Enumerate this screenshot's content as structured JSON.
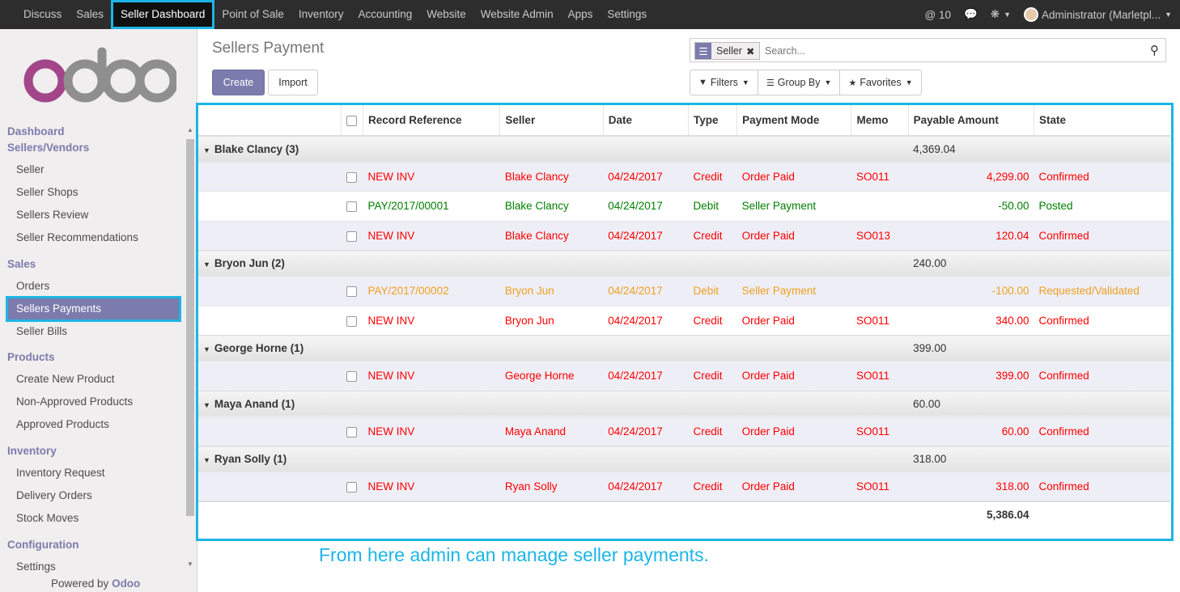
{
  "topbar": {
    "menu": [
      "Discuss",
      "Sales",
      "Seller Dashboard",
      "Point of Sale",
      "Inventory",
      "Accounting",
      "Website",
      "Website Admin",
      "Apps",
      "Settings"
    ],
    "active": "Seller Dashboard",
    "notifications": "@ 10",
    "user": "Administrator (Marletpl..."
  },
  "sidebar": {
    "logo_text": "odoo",
    "sections": [
      {
        "head": "Dashboard"
      },
      {
        "head": "Sellers/Vendors",
        "items": [
          "Seller",
          "Seller Shops",
          "Sellers Review",
          "Seller Recommendations"
        ]
      },
      {
        "head": "Sales",
        "items": [
          "Orders",
          "Sellers Payments",
          "Seller Bills"
        ]
      },
      {
        "head": "Products",
        "items": [
          "Create New Product",
          "Non-Approved Products",
          "Approved Products"
        ]
      },
      {
        "head": "Inventory",
        "items": [
          "Inventory Request",
          "Delivery Orders",
          "Stock Moves"
        ]
      },
      {
        "head": "Configuration",
        "items": [
          "Settings"
        ]
      }
    ],
    "active_item": "Sellers Payments",
    "powered_prefix": "Powered by",
    "powered_brand": "Odoo"
  },
  "control": {
    "title": "Sellers Payment",
    "create_label": "Create",
    "import_label": "Import",
    "facet_value": "Seller",
    "search_placeholder": "Search...",
    "filters_label": "Filters",
    "groupby_label": "Group By",
    "favorites_label": "Favorites"
  },
  "table": {
    "columns": [
      "Record Reference",
      "Seller",
      "Date",
      "Type",
      "Payment Mode",
      "Memo",
      "Payable Amount",
      "State"
    ],
    "groups": [
      {
        "label": "Blake Clancy (3)",
        "total": "4,369.04",
        "rows": [
          {
            "ref": "NEW INV",
            "seller": "Blake Clancy",
            "date": "04/24/2017",
            "type": "Credit",
            "mode": "Order Paid",
            "memo": "SO011",
            "amount": "4,299.00",
            "state": "Confirmed",
            "color": "red"
          },
          {
            "ref": "PAY/2017/00001",
            "seller": "Blake Clancy",
            "date": "04/24/2017",
            "type": "Debit",
            "mode": "Seller Payment",
            "memo": "",
            "amount": "-50.00",
            "state": "Posted",
            "color": "green"
          },
          {
            "ref": "NEW INV",
            "seller": "Blake Clancy",
            "date": "04/24/2017",
            "type": "Credit",
            "mode": "Order Paid",
            "memo": "SO013",
            "amount": "120.04",
            "state": "Confirmed",
            "color": "red"
          }
        ]
      },
      {
        "label": "Bryon Jun (2)",
        "total": "240.00",
        "rows": [
          {
            "ref": "PAY/2017/00002",
            "seller": "Bryon Jun",
            "date": "04/24/2017",
            "type": "Debit",
            "mode": "Seller Payment",
            "memo": "",
            "amount": "-100.00",
            "state": "Requested/Validated",
            "color": "orange"
          },
          {
            "ref": "NEW INV",
            "seller": "Bryon Jun",
            "date": "04/24/2017",
            "type": "Credit",
            "mode": "Order Paid",
            "memo": "SO011",
            "amount": "340.00",
            "state": "Confirmed",
            "color": "red"
          }
        ]
      },
      {
        "label": "George Horne (1)",
        "total": "399.00",
        "rows": [
          {
            "ref": "NEW INV",
            "seller": "George Horne",
            "date": "04/24/2017",
            "type": "Credit",
            "mode": "Order Paid",
            "memo": "SO011",
            "amount": "399.00",
            "state": "Confirmed",
            "color": "red"
          }
        ]
      },
      {
        "label": "Maya Anand (1)",
        "total": "60.00",
        "rows": [
          {
            "ref": "NEW INV",
            "seller": "Maya Anand",
            "date": "04/24/2017",
            "type": "Credit",
            "mode": "Order Paid",
            "memo": "SO011",
            "amount": "60.00",
            "state": "Confirmed",
            "color": "red"
          }
        ]
      },
      {
        "label": "Ryan Solly (1)",
        "total": "318.00",
        "rows": [
          {
            "ref": "NEW INV",
            "seller": "Ryan Solly",
            "date": "04/24/2017",
            "type": "Credit",
            "mode": "Order Paid",
            "memo": "SO011",
            "amount": "318.00",
            "state": "Confirmed",
            "color": "red"
          }
        ]
      }
    ],
    "grand_total": "5,386.04"
  },
  "annotation": "From here admin can manage seller payments.",
  "colors": {
    "brand": "#7c7bad",
    "highlight": "#1cb5e6",
    "topbar": "#2d2d2d"
  }
}
